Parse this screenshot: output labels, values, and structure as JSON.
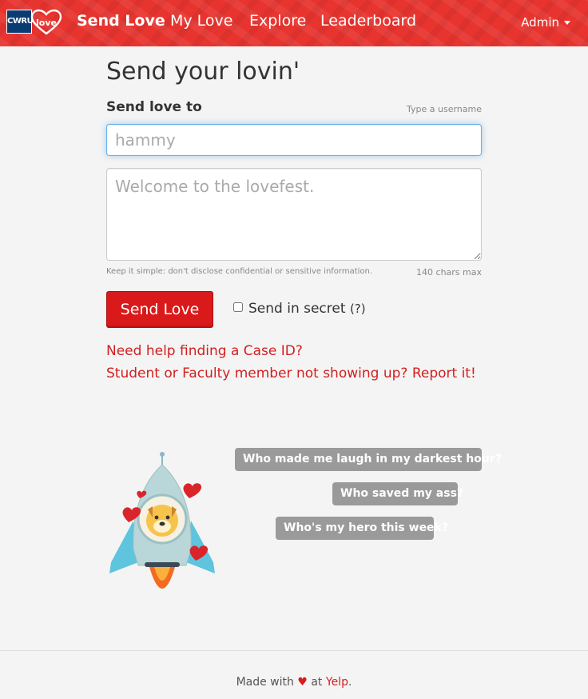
{
  "navbar": {
    "logo_text": "CWRU",
    "logo_love": "love",
    "items": [
      {
        "label": "Send Love",
        "active": true
      },
      {
        "label": "My Love"
      },
      {
        "label": "Explore"
      },
      {
        "label": "Leaderboard"
      }
    ],
    "admin_label": "Admin",
    "brand_color": "#e8342f"
  },
  "main": {
    "title": "Send your lovin'",
    "recipient_label": "Send love to",
    "recipient_hint": "Type a username",
    "recipient_placeholder": "hammy",
    "message_placeholder": "Welcome to the lovefest.",
    "help_text": "Keep it simple: don't disclose confidential or sensitive information.",
    "chars_max": "140 chars max",
    "send_button": "Send Love",
    "secret_label": "Send in secret",
    "secret_help": "(?)",
    "links": [
      "Need help finding a Case ID?",
      "Student or Faculty member not showing up? Report it!"
    ]
  },
  "prompts": [
    "Who made me laugh in my darkest hour?",
    "Who saved my ass?",
    "Who's my hero this week?"
  ],
  "footer": {
    "made_with": "Made with",
    "heart": "♥",
    "at": "at",
    "yelp": "Yelp",
    "period": "."
  },
  "icons": {
    "rocket": "rocket-illustration",
    "caret": "caret-down-icon"
  }
}
